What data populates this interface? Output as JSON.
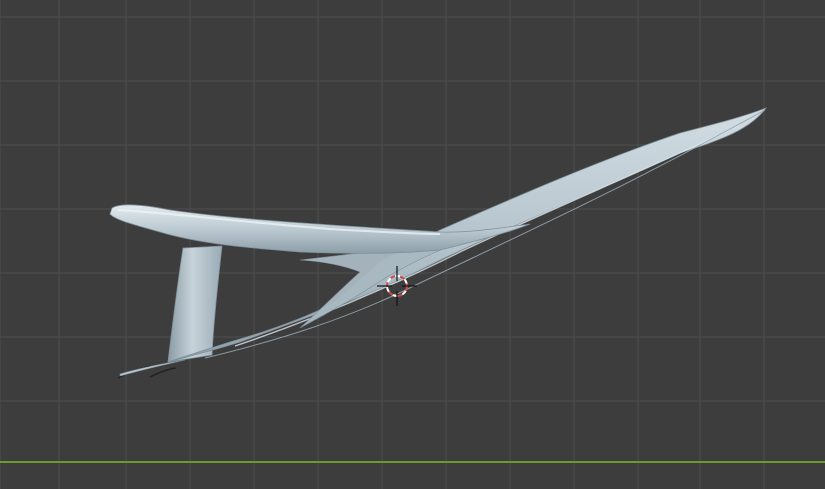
{
  "viewport": {
    "view": "3d-viewport",
    "shading": "solid",
    "background_color": "#3d3d3d",
    "grid_line_color": "#4f4f4f",
    "ground_axis_color": "#6a9a2a",
    "mesh_color": "#b7c5ce",
    "cursor_icon": "3d-cursor-icon",
    "cursor_colors": {
      "ring_red": "#d24a4a",
      "ring_white": "#ffffff",
      "crosshair": "#111111"
    }
  }
}
